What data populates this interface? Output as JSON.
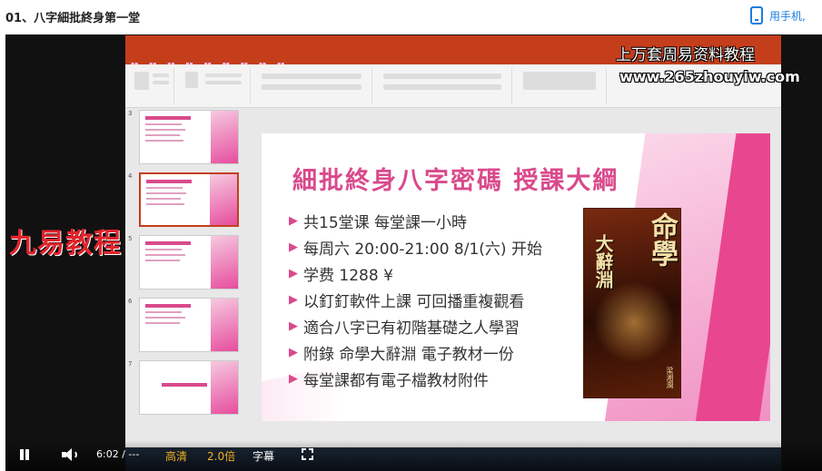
{
  "page": {
    "title": "01、八字細批終身第一堂",
    "mobile_link": "用手机,"
  },
  "watermarks": {
    "top_right": "上万套周易资料教程",
    "url": "www.265zhouyiw.com",
    "left": "九易教程"
  },
  "slide": {
    "title": "細批終身八字密碼 授課大綱",
    "bullets": [
      "共15堂课 每堂課一小時",
      "每周六 20:00-21:00 8/1(六) 开始",
      "学费 1288 ¥",
      "以釘釘軟件上課 可回播重複觀看",
      "適合八字已有初階基礎之人學習",
      "附錄 命學大辭淵 電子教材一份",
      "每堂課都有電子檔教材附件"
    ],
    "book": {
      "title_main": "命學",
      "title_sub": "大辭淵",
      "author": "梁湘潤"
    }
  },
  "player": {
    "time": "6:02 / ---",
    "quality": "高清",
    "speed": "2.0倍",
    "subtitle": "字幕"
  },
  "thumbnails": [
    {
      "num": "3"
    },
    {
      "num": "4"
    },
    {
      "num": "5"
    },
    {
      "num": "6"
    },
    {
      "num": "7"
    }
  ],
  "colors": {
    "accent": "#d94a8c",
    "ppt_red": "#c43e1c",
    "link_blue": "#1a7de0",
    "player_highlight": "#f0b020"
  }
}
